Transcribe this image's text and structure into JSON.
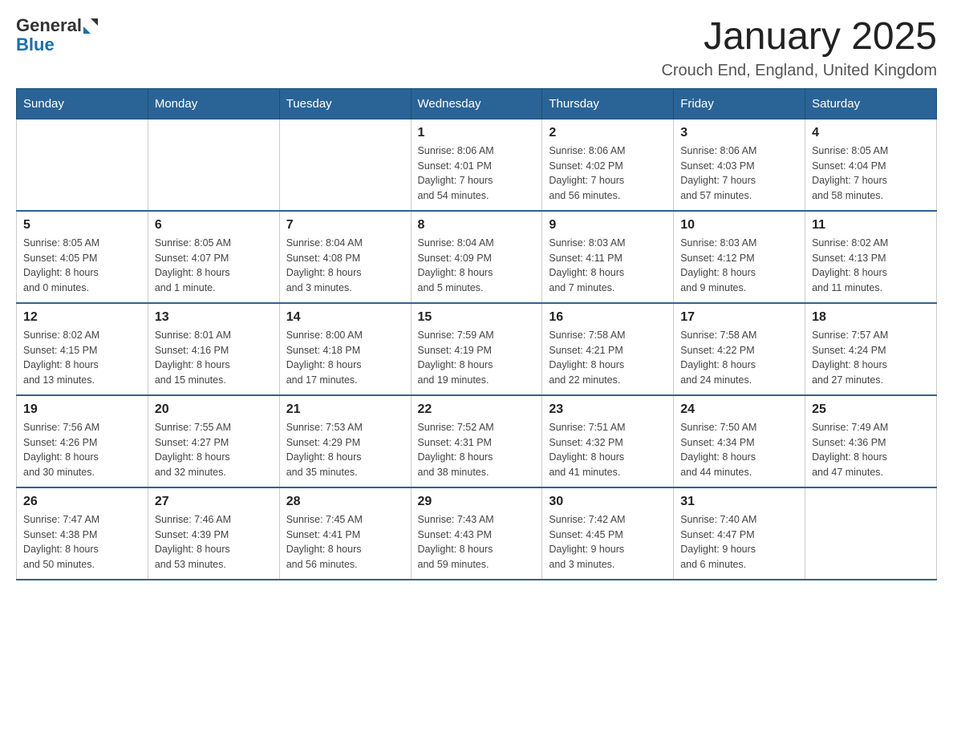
{
  "logo": {
    "text_general": "General",
    "text_blue": "Blue"
  },
  "header": {
    "title": "January 2025",
    "subtitle": "Crouch End, England, United Kingdom"
  },
  "days_of_week": [
    "Sunday",
    "Monday",
    "Tuesday",
    "Wednesday",
    "Thursday",
    "Friday",
    "Saturday"
  ],
  "weeks": [
    [
      {
        "day": "",
        "info": ""
      },
      {
        "day": "",
        "info": ""
      },
      {
        "day": "",
        "info": ""
      },
      {
        "day": "1",
        "info": "Sunrise: 8:06 AM\nSunset: 4:01 PM\nDaylight: 7 hours\nand 54 minutes."
      },
      {
        "day": "2",
        "info": "Sunrise: 8:06 AM\nSunset: 4:02 PM\nDaylight: 7 hours\nand 56 minutes."
      },
      {
        "day": "3",
        "info": "Sunrise: 8:06 AM\nSunset: 4:03 PM\nDaylight: 7 hours\nand 57 minutes."
      },
      {
        "day": "4",
        "info": "Sunrise: 8:05 AM\nSunset: 4:04 PM\nDaylight: 7 hours\nand 58 minutes."
      }
    ],
    [
      {
        "day": "5",
        "info": "Sunrise: 8:05 AM\nSunset: 4:05 PM\nDaylight: 8 hours\nand 0 minutes."
      },
      {
        "day": "6",
        "info": "Sunrise: 8:05 AM\nSunset: 4:07 PM\nDaylight: 8 hours\nand 1 minute."
      },
      {
        "day": "7",
        "info": "Sunrise: 8:04 AM\nSunset: 4:08 PM\nDaylight: 8 hours\nand 3 minutes."
      },
      {
        "day": "8",
        "info": "Sunrise: 8:04 AM\nSunset: 4:09 PM\nDaylight: 8 hours\nand 5 minutes."
      },
      {
        "day": "9",
        "info": "Sunrise: 8:03 AM\nSunset: 4:11 PM\nDaylight: 8 hours\nand 7 minutes."
      },
      {
        "day": "10",
        "info": "Sunrise: 8:03 AM\nSunset: 4:12 PM\nDaylight: 8 hours\nand 9 minutes."
      },
      {
        "day": "11",
        "info": "Sunrise: 8:02 AM\nSunset: 4:13 PM\nDaylight: 8 hours\nand 11 minutes."
      }
    ],
    [
      {
        "day": "12",
        "info": "Sunrise: 8:02 AM\nSunset: 4:15 PM\nDaylight: 8 hours\nand 13 minutes."
      },
      {
        "day": "13",
        "info": "Sunrise: 8:01 AM\nSunset: 4:16 PM\nDaylight: 8 hours\nand 15 minutes."
      },
      {
        "day": "14",
        "info": "Sunrise: 8:00 AM\nSunset: 4:18 PM\nDaylight: 8 hours\nand 17 minutes."
      },
      {
        "day": "15",
        "info": "Sunrise: 7:59 AM\nSunset: 4:19 PM\nDaylight: 8 hours\nand 19 minutes."
      },
      {
        "day": "16",
        "info": "Sunrise: 7:58 AM\nSunset: 4:21 PM\nDaylight: 8 hours\nand 22 minutes."
      },
      {
        "day": "17",
        "info": "Sunrise: 7:58 AM\nSunset: 4:22 PM\nDaylight: 8 hours\nand 24 minutes."
      },
      {
        "day": "18",
        "info": "Sunrise: 7:57 AM\nSunset: 4:24 PM\nDaylight: 8 hours\nand 27 minutes."
      }
    ],
    [
      {
        "day": "19",
        "info": "Sunrise: 7:56 AM\nSunset: 4:26 PM\nDaylight: 8 hours\nand 30 minutes."
      },
      {
        "day": "20",
        "info": "Sunrise: 7:55 AM\nSunset: 4:27 PM\nDaylight: 8 hours\nand 32 minutes."
      },
      {
        "day": "21",
        "info": "Sunrise: 7:53 AM\nSunset: 4:29 PM\nDaylight: 8 hours\nand 35 minutes."
      },
      {
        "day": "22",
        "info": "Sunrise: 7:52 AM\nSunset: 4:31 PM\nDaylight: 8 hours\nand 38 minutes."
      },
      {
        "day": "23",
        "info": "Sunrise: 7:51 AM\nSunset: 4:32 PM\nDaylight: 8 hours\nand 41 minutes."
      },
      {
        "day": "24",
        "info": "Sunrise: 7:50 AM\nSunset: 4:34 PM\nDaylight: 8 hours\nand 44 minutes."
      },
      {
        "day": "25",
        "info": "Sunrise: 7:49 AM\nSunset: 4:36 PM\nDaylight: 8 hours\nand 47 minutes."
      }
    ],
    [
      {
        "day": "26",
        "info": "Sunrise: 7:47 AM\nSunset: 4:38 PM\nDaylight: 8 hours\nand 50 minutes."
      },
      {
        "day": "27",
        "info": "Sunrise: 7:46 AM\nSunset: 4:39 PM\nDaylight: 8 hours\nand 53 minutes."
      },
      {
        "day": "28",
        "info": "Sunrise: 7:45 AM\nSunset: 4:41 PM\nDaylight: 8 hours\nand 56 minutes."
      },
      {
        "day": "29",
        "info": "Sunrise: 7:43 AM\nSunset: 4:43 PM\nDaylight: 8 hours\nand 59 minutes."
      },
      {
        "day": "30",
        "info": "Sunrise: 7:42 AM\nSunset: 4:45 PM\nDaylight: 9 hours\nand 3 minutes."
      },
      {
        "day": "31",
        "info": "Sunrise: 7:40 AM\nSunset: 4:47 PM\nDaylight: 9 hours\nand 6 minutes."
      },
      {
        "day": "",
        "info": ""
      }
    ]
  ]
}
